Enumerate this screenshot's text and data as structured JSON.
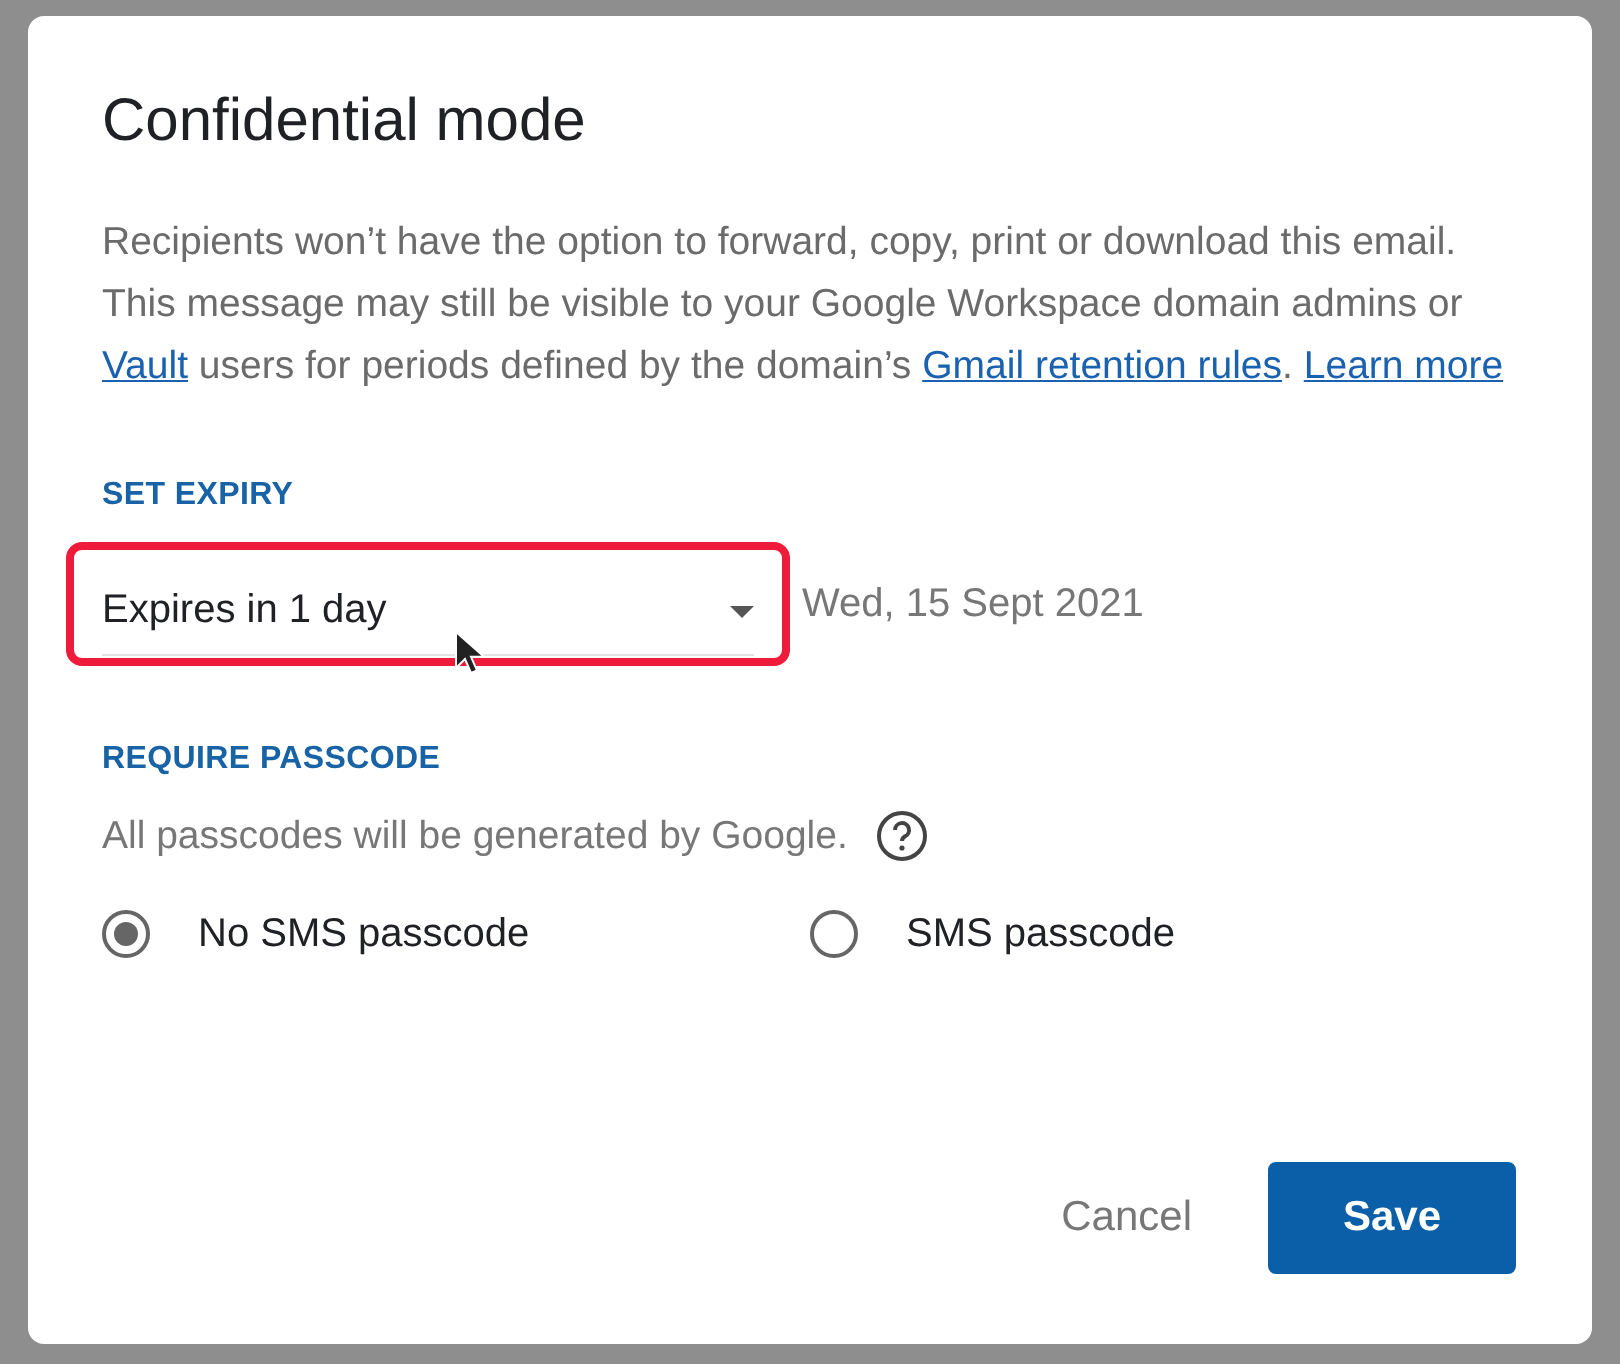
{
  "dialog": {
    "title": "Confidential mode",
    "description": [
      {
        "kind": "text",
        "text": "Recipients won’t have the option to forward, copy, print or download this email. This message may still be visible to your Google Workspace domain admins or "
      },
      {
        "kind": "link",
        "text": "Vault"
      },
      {
        "kind": "text",
        "text": " users for periods defined by the domain’s "
      },
      {
        "kind": "link",
        "text": "Gmail retention rules"
      },
      {
        "kind": "text",
        "text": ". "
      },
      {
        "kind": "link",
        "text": "Learn more"
      }
    ],
    "expiry": {
      "heading": "SET EXPIRY",
      "value": "Expires in 1 day",
      "highlighted": true,
      "date": "Wed, 15 Sept 2021"
    },
    "passcode": {
      "heading": "REQUIRE PASSCODE",
      "note": "All passcodes will be generated by Google.",
      "options": [
        {
          "label": "No SMS passcode",
          "selected": true
        },
        {
          "label": "SMS passcode",
          "selected": false
        }
      ]
    },
    "buttons": [
      {
        "label": "Cancel",
        "kind": "text"
      },
      {
        "label": "Save",
        "kind": "primary"
      }
    ]
  }
}
